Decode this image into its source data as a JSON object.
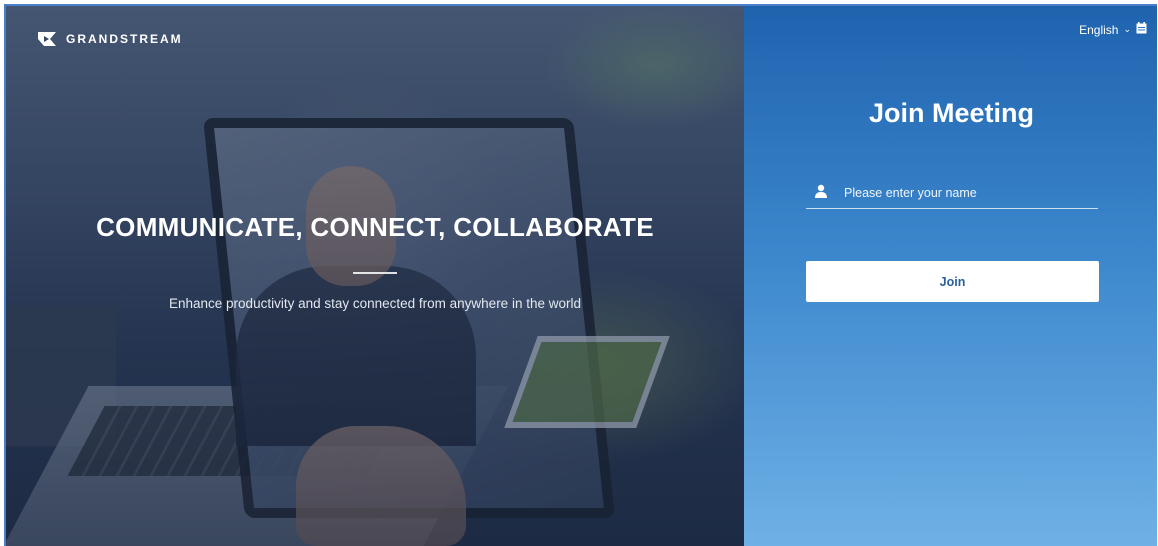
{
  "brand": {
    "logo_text": "GRANDSTREAM",
    "logo_icon": "grandstream-logo-icon"
  },
  "hero": {
    "headline": "COMMUNICATE, CONNECT, COLLABORATE",
    "subline": "Enhance productivity and stay connected from anywhere in the world"
  },
  "language": {
    "selected": "English",
    "chevron_icon": "chevron-down-icon",
    "extra_icon": "calendar-icon"
  },
  "join": {
    "title": "Join Meeting",
    "name_placeholder": "Please enter your name",
    "name_value": "",
    "user_icon": "user-icon",
    "button_label": "Join"
  },
  "colors": {
    "panel_top": "#1f63ae",
    "panel_bottom": "#6fb1e6",
    "button_text": "#2a5f9a",
    "white": "#ffffff"
  }
}
